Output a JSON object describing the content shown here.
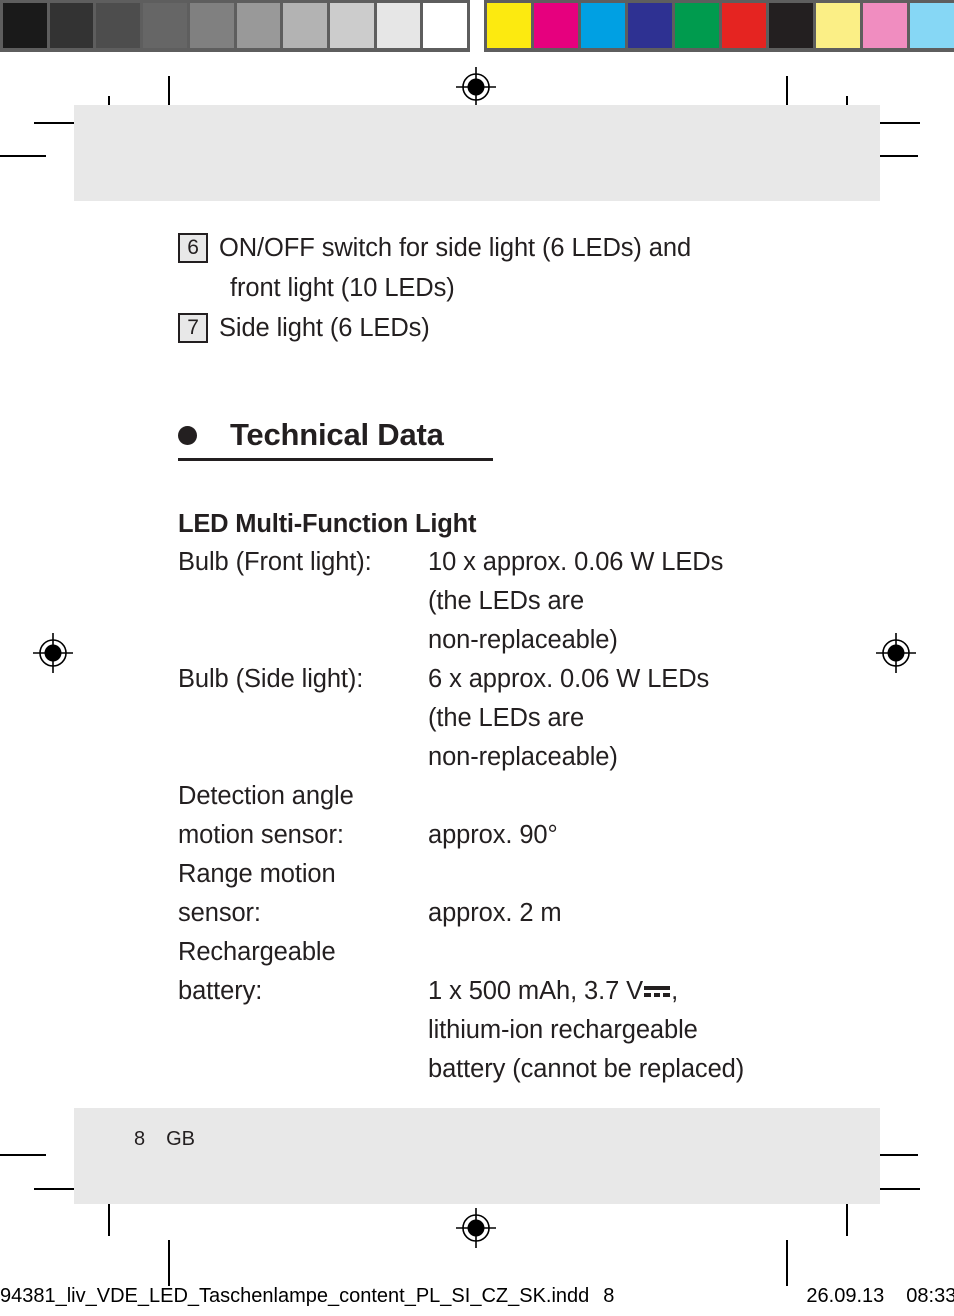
{
  "calibration": {
    "grayscale_swatches": [
      "#1a1a1a",
      "#333333",
      "#4d4d4d",
      "#666666",
      "#808080",
      "#999999",
      "#b3b3b3",
      "#cccccc",
      "#e6e6e6",
      "#ffffff"
    ],
    "color_swatches": [
      "#fcea10",
      "#e6007e",
      "#00a0e3",
      "#2e3192",
      "#009b4e",
      "#e52421",
      "#231f20",
      "#fbef86",
      "#f08dc0",
      "#86d7f5"
    ]
  },
  "page": {
    "legend": {
      "items": [
        {
          "number": "6",
          "line1": "ON/OFF switch for side light (6 LEDs) and",
          "line2": "front light (10 LEDs)"
        },
        {
          "number": "7",
          "line1": "Side light (6 LEDs)",
          "line2": ""
        }
      ]
    },
    "section": {
      "heading": "Technical Data",
      "bullet": "bullet-dot-icon"
    },
    "spec": {
      "title": "LED Multi-Function Light",
      "rows": [
        {
          "label": "Bulb (Front light):",
          "value_lines": [
            "10 x approx. 0.06 W LEDs",
            "(the LEDs are",
            "non-replaceable)"
          ]
        },
        {
          "label": "Bulb (Side light):",
          "value_lines": [
            "6 x approx. 0.06 W LEDs",
            "(the LEDs are",
            "non-replaceable)"
          ]
        },
        {
          "label": "Detection angle",
          "value_lines": [
            ""
          ]
        },
        {
          "label": "motion sensor:",
          "value_lines": [
            "approx. 90°"
          ]
        },
        {
          "label": "Range motion",
          "value_lines": [
            ""
          ]
        },
        {
          "label": "sensor:",
          "value_lines": [
            "approx. 2 m"
          ]
        },
        {
          "label": "Rechargeable",
          "value_lines": [
            ""
          ]
        },
        {
          "label": "battery:",
          "value_lines": [
            "1 x 500 mAh, 3.7 V",
            "lithium-ion rechargeable",
            "battery (cannot be replaced)"
          ],
          "value_line1_prefix": "1 x 500 mAh, 3.7 V",
          "value_line1_suffix": ",",
          "dc_symbol": "dc-current-icon"
        }
      ]
    },
    "footer": {
      "page_number": "8",
      "language_code": "GB"
    }
  },
  "slug": {
    "filename": "94381_liv_VDE_LED_Taschenlampe_content_PL_SI_CZ_SK.indd",
    "page": "8",
    "date": "26.09.13",
    "time": "08:33"
  }
}
